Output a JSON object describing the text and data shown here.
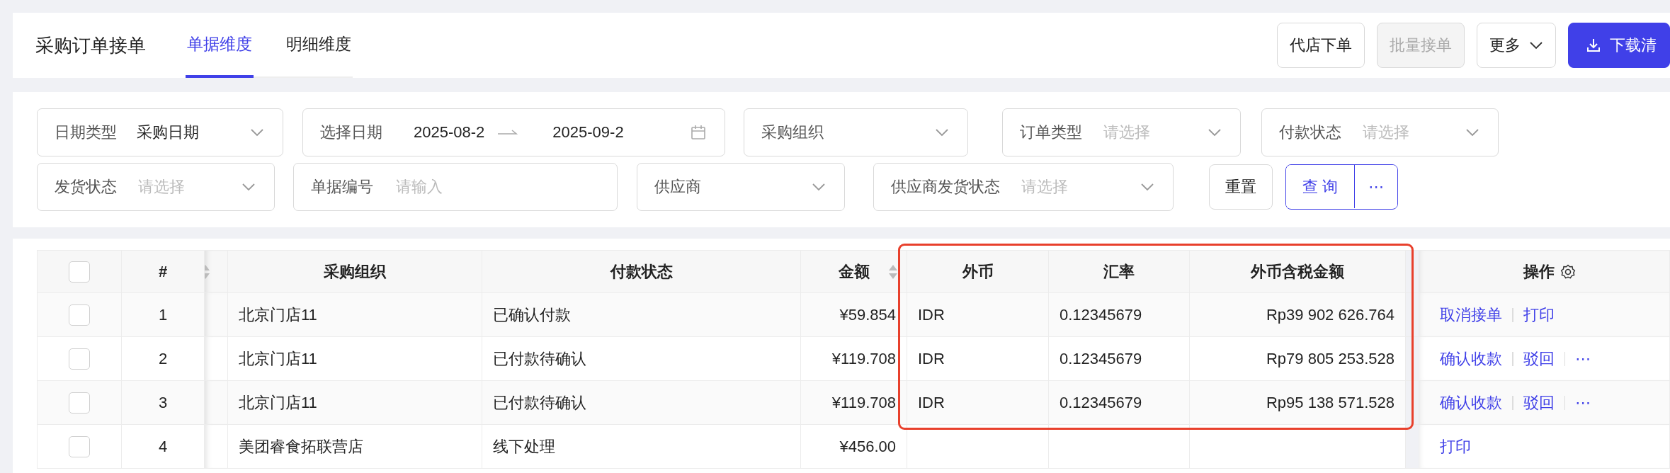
{
  "header": {
    "title": "采购订单接单",
    "tabs": [
      {
        "label": "单据维度",
        "selected": true
      },
      {
        "label": "明细维度",
        "selected": false
      }
    ],
    "actions": [
      {
        "label": "代店下单",
        "kind": "default",
        "disabled": false
      },
      {
        "label": "批量接单",
        "kind": "default",
        "disabled": true
      },
      {
        "label": "更多",
        "kind": "dropdown",
        "disabled": false
      },
      {
        "label": "下载清",
        "kind": "download",
        "disabled": false
      }
    ]
  },
  "filter_rows": [
    {
      "fields": [
        {
          "label": "日期类型",
          "kind": "select",
          "value": "采购日期"
        },
        {
          "label": "选择日期",
          "kind": "daterange",
          "start": "2025-08-2",
          "end": "2025-09-2"
        },
        {
          "label": "采购组织",
          "kind": "select"
        },
        {
          "label": "订单类型",
          "kind": "select",
          "placeholder": "请选择"
        },
        {
          "label": "付款状态",
          "kind": "select",
          "placeholder": "请选择"
        }
      ]
    },
    {
      "fields": [
        {
          "label": "发货状态",
          "kind": "select",
          "placeholder": "请选择"
        },
        {
          "label": "单据编号",
          "kind": "input",
          "placeholder": "请输入"
        },
        {
          "label": "供应商",
          "kind": "select"
        },
        {
          "label": "供应商发货状态",
          "kind": "select",
          "placeholder": "请选择"
        }
      ]
    }
  ],
  "filter_buttons": {
    "reset": "重置",
    "query": "查 询",
    "more": "⋯"
  },
  "table": {
    "select_all": {
      "checked": false
    },
    "hidden_column_sortable": true,
    "columns": [
      {
        "label": "#",
        "sortable": false
      },
      {
        "label": "采购组织",
        "sortable": false
      },
      {
        "label": "付款状态",
        "sortable": false
      },
      {
        "label": "金额",
        "sortable": true
      },
      {
        "label": "外币",
        "sortable": false
      },
      {
        "label": "汇率",
        "sortable": false
      },
      {
        "label": "外币含税金额",
        "sortable": false
      },
      {
        "label": "操作",
        "sortable": false,
        "settings": true
      }
    ],
    "rows": [
      {
        "checked": false,
        "index": "1",
        "org": "北京门店11",
        "payment_status": "已确认付款",
        "amount": "¥59.854",
        "currency": "IDR",
        "rate": "0.12345679",
        "foreign_amount": "Rp39 902 626.764",
        "actions": [
          {
            "label": "取消接单",
            "kind": "link"
          },
          {
            "label": "打印",
            "kind": "link"
          }
        ]
      },
      {
        "checked": false,
        "index": "2",
        "org": "北京门店11",
        "payment_status": "已付款待确认",
        "amount": "¥119.708",
        "currency": "IDR",
        "rate": "0.12345679",
        "foreign_amount": "Rp79 805 253.528",
        "actions": [
          {
            "label": "确认收款",
            "kind": "link"
          },
          {
            "label": "驳回",
            "kind": "link"
          },
          {
            "label": "⋯",
            "kind": "more"
          }
        ]
      },
      {
        "checked": false,
        "index": "3",
        "org": "北京门店11",
        "payment_status": "已付款待确认",
        "amount": "¥119.708",
        "currency": "IDR",
        "rate": "0.12345679",
        "foreign_amount": "Rp95 138 571.528",
        "actions": [
          {
            "label": "确认收款",
            "kind": "link"
          },
          {
            "label": "驳回",
            "kind": "link"
          },
          {
            "label": "⋯",
            "kind": "more"
          }
        ]
      },
      {
        "checked": false,
        "index": "4",
        "org": "美团睿食拓联营店",
        "payment_status": "线下处理",
        "amount": "¥456.00",
        "actions": [
          {
            "label": "打印",
            "kind": "link"
          }
        ]
      }
    ]
  }
}
